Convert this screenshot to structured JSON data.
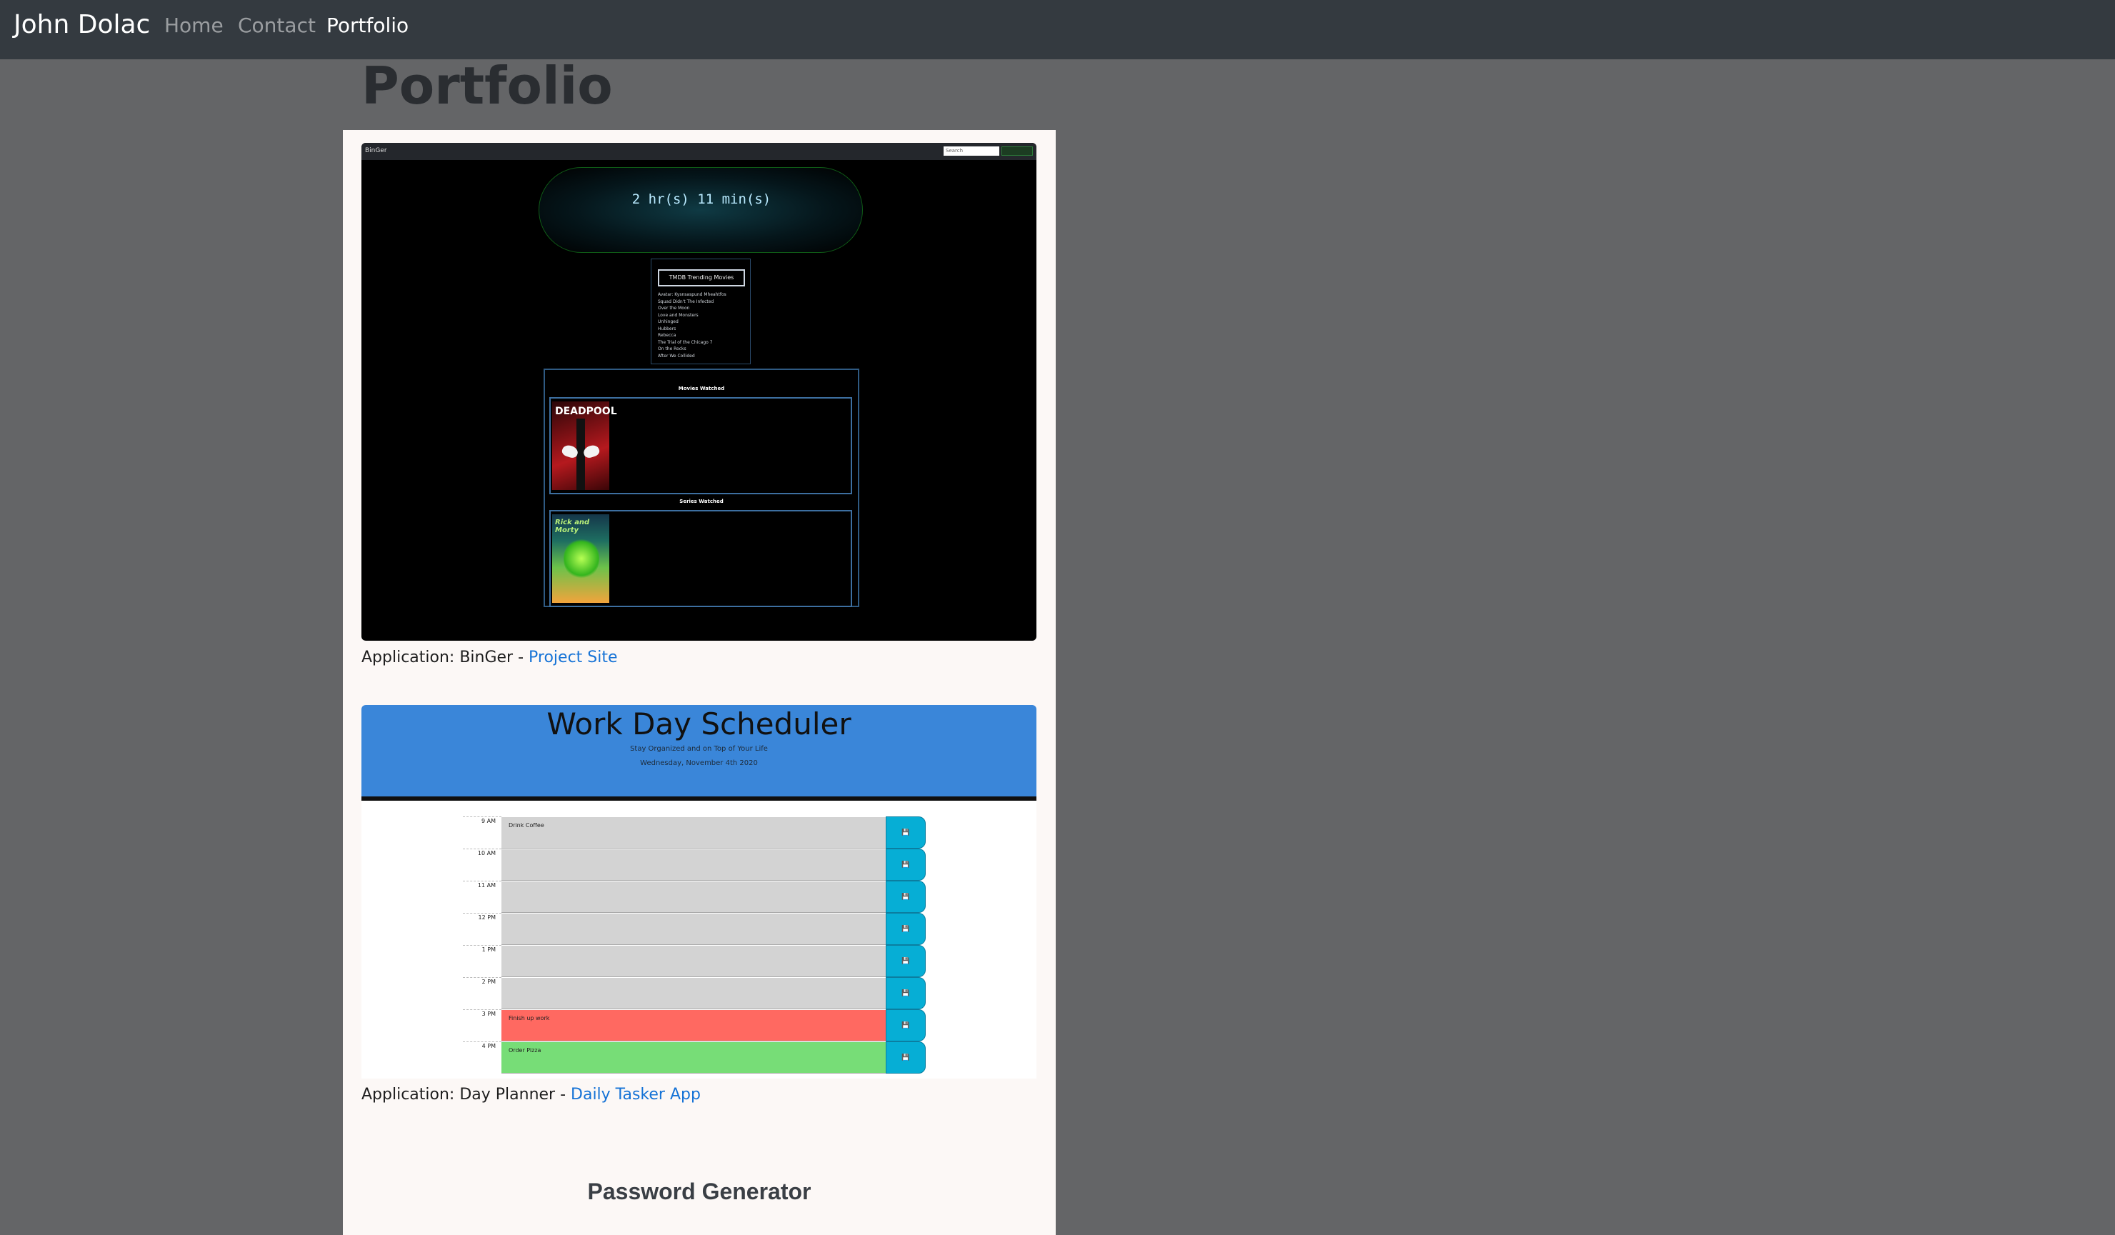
{
  "navbar": {
    "brand": "John Dolac",
    "links": [
      {
        "label": "Home",
        "active": false
      },
      {
        "label": "Contact",
        "active": false
      },
      {
        "label": "Portfolio",
        "active": true
      }
    ]
  },
  "page": {
    "title": "Portfolio"
  },
  "projects": [
    {
      "prefix": "Application: BinGer - ",
      "link_label": "Project Site",
      "screenshot": {
        "app_name": "BinGer",
        "search_placeholder": "Search",
        "timer": "2 hr(s) 11 min(s)",
        "trending_title": "TMDB Trending Movies",
        "trending": [
          "Avatar: Kysnsaspund Mheahtfos",
          "Squad Didn't The Infected",
          "Over the Moon",
          "Love and Monsters",
          "Unhinged",
          "Hubbers",
          "Rebecca",
          "The Trial of the Chicago 7",
          "On the Rocks",
          "After We Collided"
        ],
        "movies_label": "Movies Watched",
        "series_label": "Series Watched",
        "movie_poster": "DEADPOOL",
        "series_poster": "Rick and Morty"
      }
    },
    {
      "prefix": "Application: Day Planner - ",
      "link_label": "Daily Tasker App",
      "screenshot": {
        "title": "Work Day Scheduler",
        "subtitle": "Stay Organized and on Top of Your Life",
        "date": "Wednesday, November 4th 2020",
        "save_icon": "save-icon",
        "rows": [
          {
            "hour": "9 AM",
            "text": "Drink Coffee",
            "state": "past"
          },
          {
            "hour": "10 AM",
            "text": "",
            "state": "past"
          },
          {
            "hour": "11 AM",
            "text": "",
            "state": "past"
          },
          {
            "hour": "12 PM",
            "text": "",
            "state": "past"
          },
          {
            "hour": "1 PM",
            "text": "",
            "state": "past"
          },
          {
            "hour": "2 PM",
            "text": "",
            "state": "past"
          },
          {
            "hour": "3 PM",
            "text": "Finish up work",
            "state": "present"
          },
          {
            "hour": "4 PM",
            "text": "Order Pizza",
            "state": "future"
          }
        ]
      }
    },
    {
      "title": "Password Generator"
    }
  ]
}
